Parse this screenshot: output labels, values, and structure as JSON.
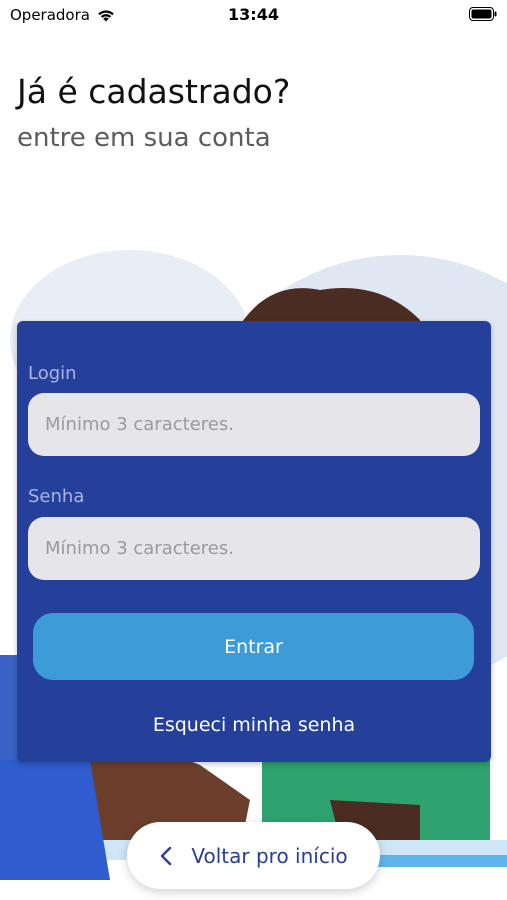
{
  "status_bar": {
    "carrier": "Operadora",
    "time": "13:44",
    "wifi_icon": "wifi-icon",
    "battery_icon": "battery-icon"
  },
  "header": {
    "title": "Já é cadastrado?",
    "subtitle": "entre em sua conta"
  },
  "form": {
    "login_label": "Login",
    "login_placeholder": "Mínimo 3 caracteres.",
    "login_value": "",
    "senha_label": "Senha",
    "senha_placeholder": "Mínimo 3 caracteres.",
    "senha_value": "",
    "submit_label": "Entrar",
    "forgot_label": "Esqueci minha senha"
  },
  "footer": {
    "back_label": "Voltar pro início",
    "back_icon": "chevron-left-icon"
  },
  "colors": {
    "card": "#25409a",
    "button": "#3d9bd8",
    "input_bg": "#e5e5ea",
    "back_text": "#2a3f93"
  }
}
